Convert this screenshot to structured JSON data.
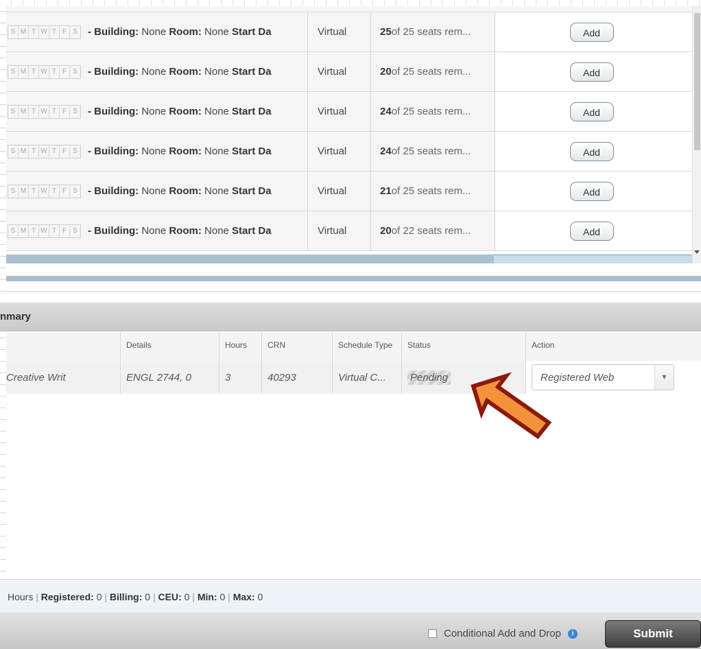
{
  "results": {
    "days": [
      "S",
      "M",
      "T",
      "W",
      "T",
      "F",
      "S"
    ],
    "building_label": "- Building:",
    "building_value": "None",
    "room_label": "Room:",
    "room_value": "None",
    "start_label": "Start Da",
    "rows": [
      {
        "mode": "Virtual",
        "seats_bold": "25",
        "seats_rest": " of 25 seats rem...",
        "action": "Add"
      },
      {
        "mode": "Virtual",
        "seats_bold": "20",
        "seats_rest": " of 25 seats rem...",
        "action": "Add"
      },
      {
        "mode": "Virtual",
        "seats_bold": "24",
        "seats_rest": " of 25 seats rem...",
        "action": "Add"
      },
      {
        "mode": "Virtual",
        "seats_bold": "24",
        "seats_rest": " of 25 seats rem...",
        "action": "Add"
      },
      {
        "mode": "Virtual",
        "seats_bold": "21",
        "seats_rest": " of 25 seats rem...",
        "action": "Add"
      },
      {
        "mode": "Virtual",
        "seats_bold": "20",
        "seats_rest": " of 22 seats rem...",
        "action": "Add"
      }
    ]
  },
  "summary": {
    "header": "nmary",
    "columns": {
      "title": "",
      "details": "Details",
      "hours": "Hours",
      "crn": "CRN",
      "schedule_type": "Schedule Type",
      "status": "Status",
      "action": "Action"
    },
    "row": {
      "title": "Creative Writ",
      "details": "ENGL 2744, 0",
      "hours": "3",
      "crn": "40293",
      "schedule_type": "Virtual C...",
      "status": "Pending",
      "action": "Registered Web"
    }
  },
  "footer": {
    "hours_label": "Hours",
    "registered_label": "Registered:",
    "registered_value": "0",
    "billing_label": "Billing:",
    "billing_value": "0",
    "ceu_label": "CEU:",
    "ceu_value": "0",
    "min_label": "Min:",
    "min_value": "0",
    "max_label": "Max:",
    "max_value": "0",
    "conditional_label": "Conditional Add and Drop",
    "submit_label": "Submit"
  },
  "colors": {
    "arrow_fill": "#f4923c",
    "arrow_stroke": "#8b1a0c",
    "accent_blue": "#a9c1d1"
  }
}
